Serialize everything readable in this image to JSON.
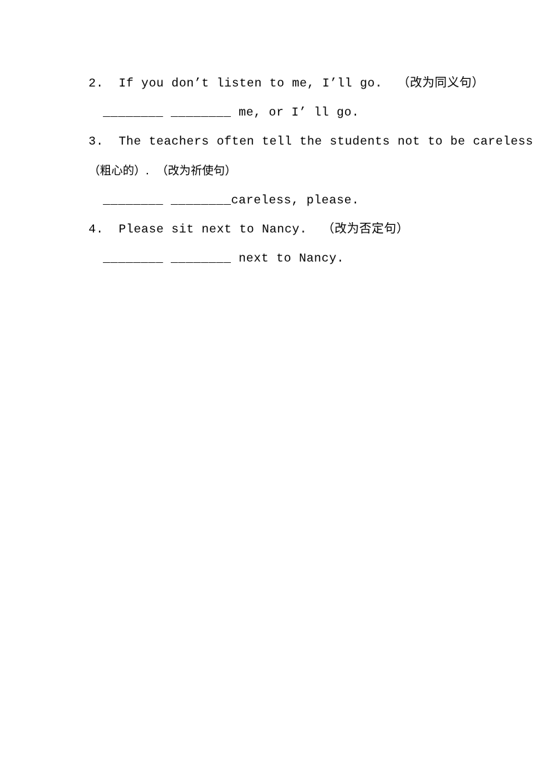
{
  "document": {
    "type": "worksheet",
    "language": "en-zh",
    "background_color": "#ffffff",
    "text_color": "#000000"
  },
  "exercises": [
    {
      "number": "2.",
      "prompt_en": "If you don’t listen to me, I’ll go.",
      "instruction_zh": "（改为同义句）",
      "question_line": "2.  If you don’t listen to me, I’ll go.  （改为同义句）",
      "answer_line": " ________ ________ me, or I’ ll go.",
      "blank_one": "________",
      "blank_two": "________",
      "answer_tail": " me, or I’ ll go."
    },
    {
      "number": "3.",
      "prompt_en": "The teachers often tell the students not to be careless",
      "gloss_zh": "（粗心的）.",
      "instruction_zh": "（改为祈使句）",
      "question_line": "3.  The teachers often tell the students not to be careless",
      "continuation_line": "（粗心的）.  （改为祈使句）",
      "answer_line": " ________ ________careless, please.",
      "blank_one": "________",
      "blank_two": "________",
      "answer_tail": "careless, please."
    },
    {
      "number": "4.",
      "prompt_en": "Please sit next to Nancy.",
      "instruction_zh": "（改为否定句）",
      "question_line": "4.  Please sit next to Nancy.  （改为否定句）",
      "answer_line": " ________ ________ next to Nancy.",
      "blank_one": "________",
      "blank_two": "________",
      "answer_tail": " next to Nancy."
    }
  ]
}
